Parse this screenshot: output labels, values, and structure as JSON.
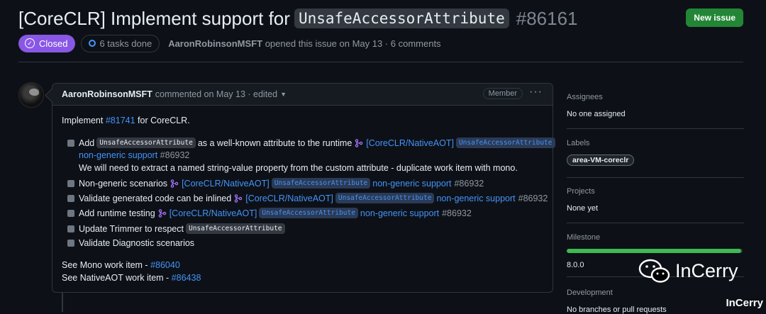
{
  "header": {
    "title_prefix": "[CoreCLR] Implement support for",
    "title_code": "UnsafeAccessorAttribute",
    "issue_number": "#86161",
    "new_issue_label": "New issue"
  },
  "meta": {
    "state": "Closed",
    "tasks": "6 tasks done",
    "author": "AaronRobinsonMSFT",
    "opened_text": "opened this issue on May 13 · 6 comments"
  },
  "comment": {
    "author": "AaronRobinsonMSFT",
    "commented_text": "commented on May 13 · edited",
    "role_badge": "Member",
    "intro_prefix": "Implement",
    "intro_link": "#81741",
    "intro_suffix": "for CoreCLR.",
    "tasks": [
      {
        "pre": "Add",
        "code": "UnsafeAccessorAttribute",
        "text": "as a well-known attribute to the runtime",
        "pr_link": "[CoreCLR/NativeAOT]",
        "pr_code": "UnsafeAccessorAttribute"
      },
      {
        "text": "Non-generic scenarios",
        "pr_link": "[CoreCLR/NativeAOT]",
        "pr_code": "UnsafeAccessorAttribute",
        "pr_tail": "non-generic support",
        "pr_num": "#86932"
      },
      {
        "text": "Validate generated code can be inlined",
        "pr_link": "[CoreCLR/NativeAOT]",
        "pr_code": "UnsafeAccessorAttribute",
        "pr_tail": "non-generic support",
        "pr_num": "#86932"
      },
      {
        "text": "Add runtime testing",
        "pr_link": "[CoreCLR/NativeAOT]",
        "pr_code": "UnsafeAccessorAttribute",
        "pr_tail": "non-generic support",
        "pr_num": "#86932"
      },
      {
        "text": "Update Trimmer to respect",
        "code": "UnsafeAccessorAttribute"
      },
      {
        "text": "Validate Diagnostic scenarios"
      }
    ],
    "task1_cont_link": "non-generic support",
    "task1_cont_num": "#86932",
    "task1_note": "We will need to extract a named string-value property from the custom attribute - duplicate work item with mono.",
    "mono_prefix": "See Mono work item -",
    "mono_link": "#86040",
    "naot_prefix": "See NativeAOT work item -",
    "naot_link": "#86438"
  },
  "sidebar": {
    "assignees_heading": "Assignees",
    "assignees_value": "No one assigned",
    "labels_heading": "Labels",
    "label_chip": "area-VM-coreclr",
    "projects_heading": "Projects",
    "projects_value": "None yet",
    "milestone_heading": "Milestone",
    "milestone_progress": 0.99,
    "milestone_value": "8.0.0",
    "development_heading": "Development",
    "development_value": "No branches or pull requests"
  },
  "watermark": {
    "brand": "InCerry",
    "small": "InCerry"
  },
  "colors": {
    "background": "#0d1117",
    "closed_purple": "#8957e5",
    "link_blue": "#4493f8",
    "new_issue_green": "#238636",
    "progress_green": "#3fb950"
  }
}
